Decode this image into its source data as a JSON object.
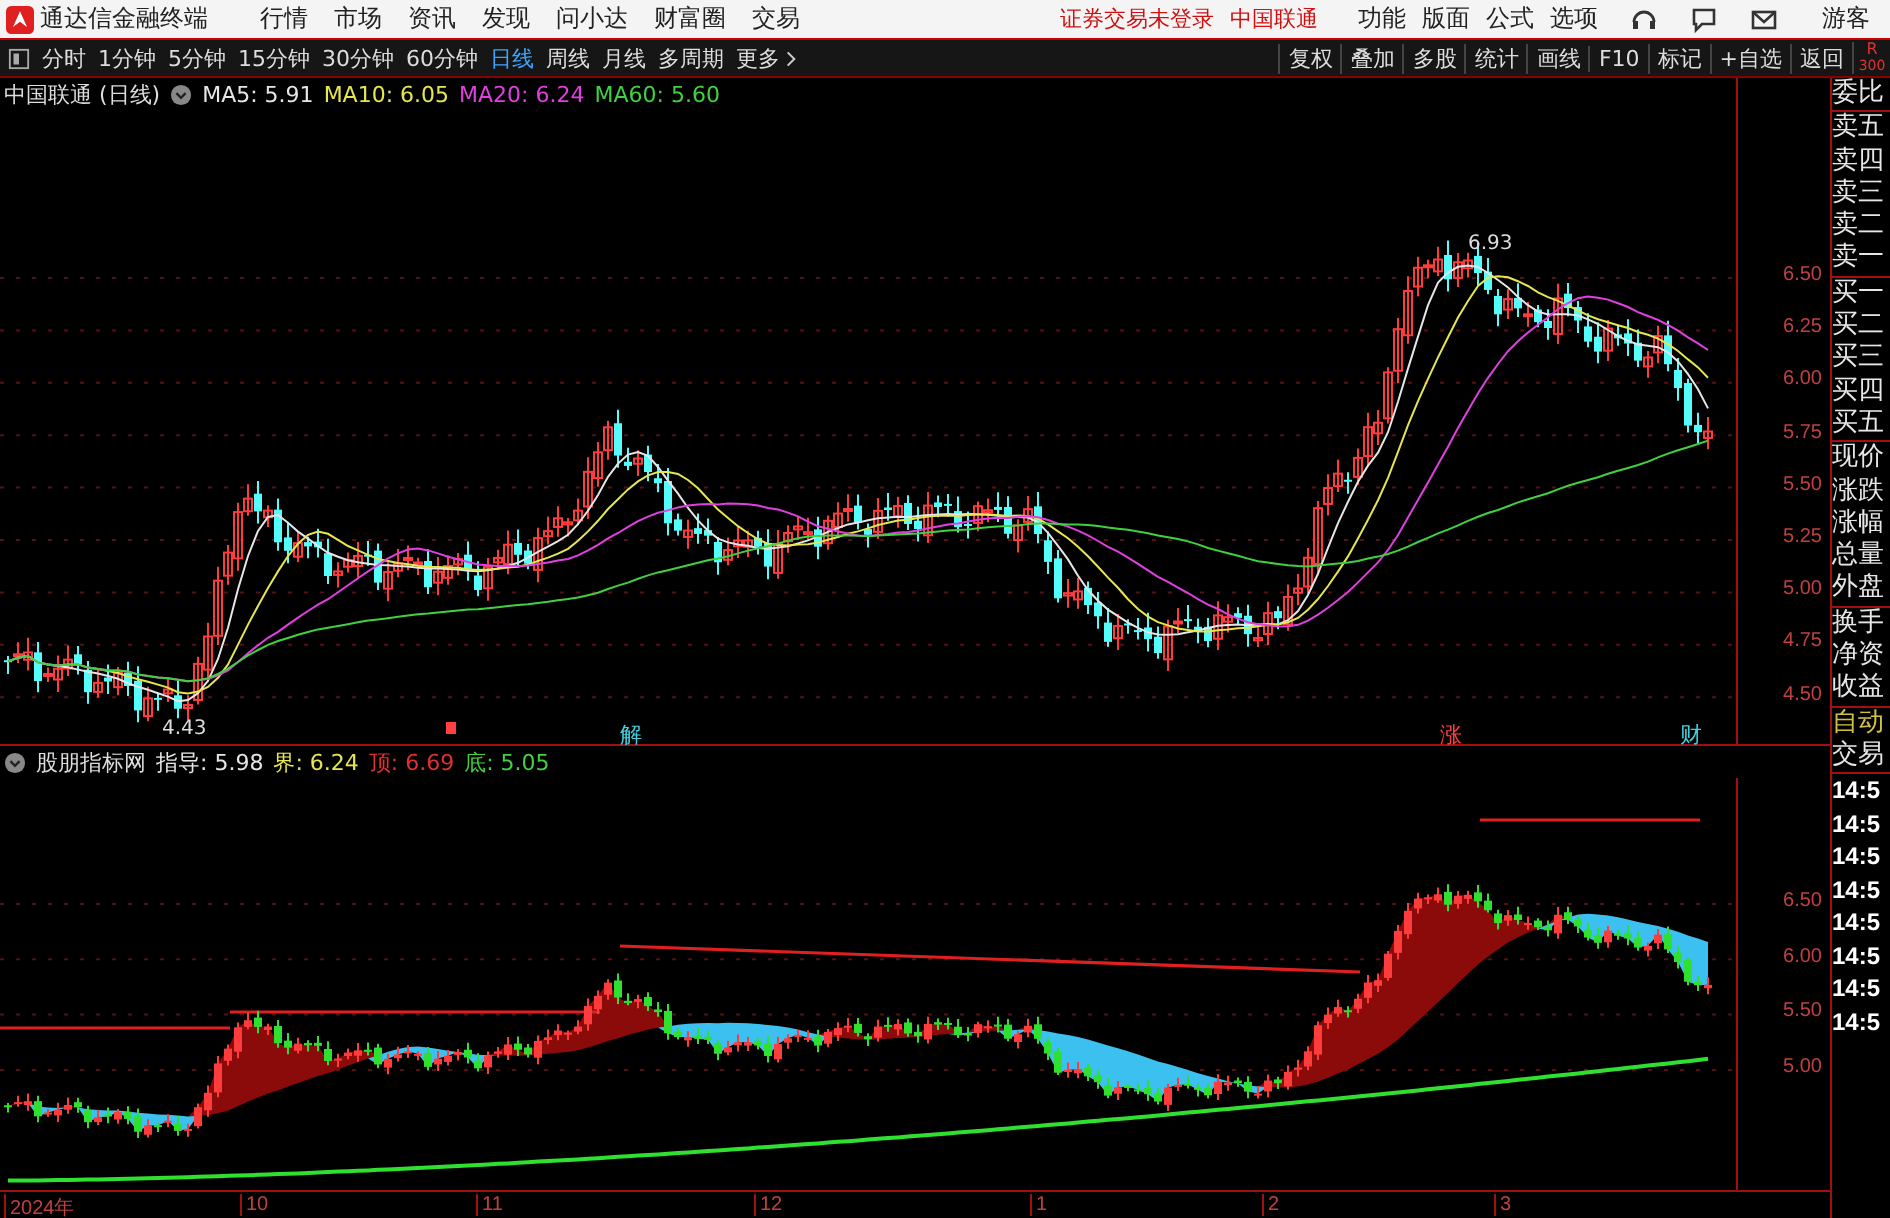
{
  "app_title": "通达信金融终端",
  "menu": [
    "行情",
    "市场",
    "资讯",
    "发现",
    "问小达",
    "财富圈",
    "交易"
  ],
  "login_status": "证券交易未登录",
  "stock_name": "中国联通",
  "right_menu": [
    "功能",
    "版面",
    "公式",
    "选项"
  ],
  "user": "游客",
  "periods": [
    {
      "label": "分时",
      "selected": false
    },
    {
      "label": "1分钟",
      "selected": false
    },
    {
      "label": "5分钟",
      "selected": false
    },
    {
      "label": "15分钟",
      "selected": false
    },
    {
      "label": "30分钟",
      "selected": false
    },
    {
      "label": "60分钟",
      "selected": false
    },
    {
      "label": "日线",
      "selected": true
    },
    {
      "label": "周线",
      "selected": false
    },
    {
      "label": "月线",
      "selected": false
    },
    {
      "label": "多周期",
      "selected": false
    }
  ],
  "more": "更多",
  "tools": [
    "复权",
    "叠加",
    "多股",
    "统计",
    "画线",
    "F10",
    "标记",
    "+自选",
    "返回"
  ],
  "corner": {
    "letter": "R",
    "code": "300"
  },
  "main_chart": {
    "title": "中国联通 (日线)",
    "ma": [
      {
        "label": "MA5: 5.91",
        "color": "#e6e6e6"
      },
      {
        "label": "MA10: 6.05",
        "color": "#e6e650"
      },
      {
        "label": "MA20: 6.24",
        "color": "#e040e0"
      },
      {
        "label": "MA60: 5.60",
        "color": "#40d040"
      }
    ],
    "price_ticks": [
      "6.50",
      "6.25",
      "6.00",
      "5.75",
      "5.50",
      "5.25",
      "5.00",
      "4.75",
      "4.50"
    ],
    "high_label": "6.93",
    "low_label": "4.43",
    "markers": [
      {
        "text": "解",
        "color": "#40d0e0"
      },
      {
        "text": "涨",
        "color": "#ff4040"
      },
      {
        "text": "财",
        "color": "#40d0e0"
      }
    ]
  },
  "indicator": {
    "name": "股朋指标网",
    "values": [
      {
        "label": "指导: 5.98",
        "color": "#e6e6e6"
      },
      {
        "label": "界: 6.24",
        "color": "#e6e650"
      },
      {
        "label": "顶: 6.69",
        "color": "#e03030"
      },
      {
        "label": "底: 5.05",
        "color": "#40d040"
      }
    ],
    "ticks": [
      "6.50",
      "6.00",
      "5.50",
      "5.00"
    ]
  },
  "x_axis": [
    "2024年",
    "10",
    "11",
    "12",
    "1",
    "2",
    "3"
  ],
  "quote_groups": [
    [
      "委比"
    ],
    [
      "卖五",
      "卖四",
      "卖三",
      "卖二",
      "卖一"
    ],
    [
      "买一",
      "买二",
      "买三",
      "买四",
      "买五"
    ],
    [
      "现价",
      "涨跌",
      "涨幅",
      "总量",
      "外盘"
    ],
    [
      "换手",
      "净资",
      "收益"
    ]
  ],
  "trade_tabs": [
    "自动",
    "交易"
  ],
  "trade_times": [
    "14:5",
    "14:5",
    "14:5",
    "14:5",
    "14:5",
    "14:5",
    "14:5",
    "14:5"
  ]
}
